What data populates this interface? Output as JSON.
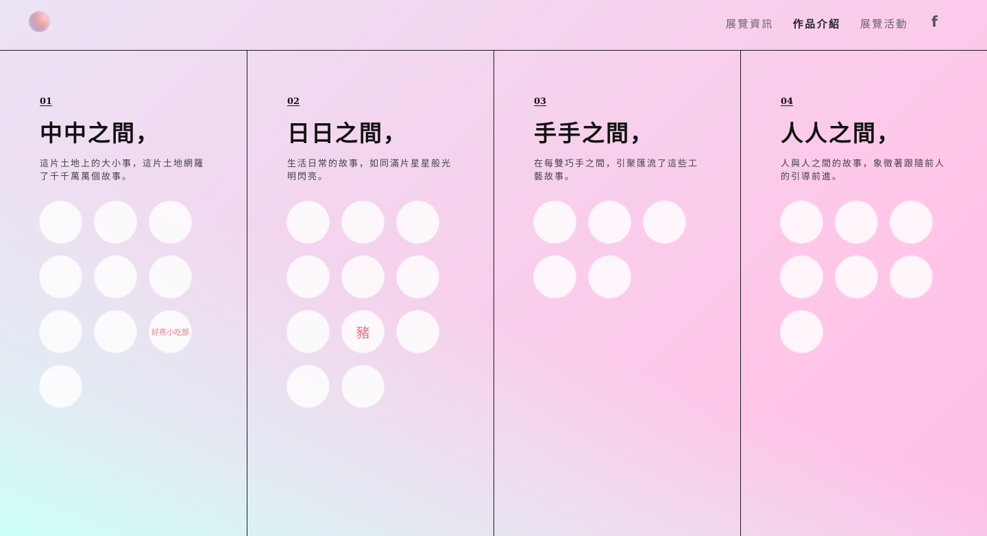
{
  "header": {
    "nav": [
      {
        "label": "展覽資訊",
        "active": false
      },
      {
        "label": "作品介紹",
        "active": true
      },
      {
        "label": "展覽活動",
        "active": false
      }
    ],
    "facebook_icon": "f"
  },
  "columns": [
    {
      "number": "01",
      "title": "中中之間，",
      "description": "這片土地上的大小事，這片土地網羅了千千萬萬個故事。",
      "badges": [
        {
          "text": "",
          "icon": "book-logo"
        },
        {
          "text": "",
          "icon": "house-logo"
        },
        {
          "text": "",
          "icon": "mountain-logo"
        },
        {
          "text": "",
          "icon": "shop-logo"
        },
        {
          "text": "",
          "icon": "lines-logo"
        },
        {
          "text": "",
          "icon": "flower-logo"
        },
        {
          "text": "",
          "icon": "character-logo"
        },
        {
          "text": "",
          "icon": "tiger-logo"
        },
        {
          "text": "好燕小吃部",
          "icon": "text-logo"
        },
        {
          "text": "",
          "icon": "calligraphy-logo"
        }
      ]
    },
    {
      "number": "02",
      "title": "日日之間，",
      "description": "生活日常的故事，如同滿片星星般光明閃亮。",
      "badges": [
        {
          "text": "",
          "icon": "script-logo"
        },
        {
          "text": "",
          "icon": "bloom-logo"
        },
        {
          "text": "",
          "icon": "lily-logo"
        },
        {
          "text": "",
          "icon": "stage-logo"
        },
        {
          "text": "",
          "icon": "cake-logo"
        },
        {
          "text": "",
          "icon": "calligraphy-logo"
        },
        {
          "text": "",
          "icon": "ribbon-logo"
        },
        {
          "text": "豬",
          "icon": "pig-logo"
        },
        {
          "text": "",
          "icon": "bowl-logo"
        },
        {
          "text": "",
          "icon": "circle-logo"
        },
        {
          "text": "",
          "icon": "lotus-logo"
        }
      ]
    },
    {
      "number": "03",
      "title": "手手之間，",
      "description": "在每雙巧手之間，引聚匯流了這些工藝故事。",
      "badges": [
        {
          "text": "",
          "icon": "line-logo"
        },
        {
          "text": "",
          "icon": "hand-logo"
        },
        {
          "text": "",
          "icon": "script-logo"
        },
        {
          "text": "",
          "icon": "flower-char-logo"
        },
        {
          "text": "",
          "icon": "face-logo"
        }
      ]
    },
    {
      "number": "04",
      "title": "人人之間，",
      "description": "人與人之間的故事，象徵著跟隨前人的引導前進。",
      "badges": [
        {
          "text": "",
          "icon": "portrait-logo"
        },
        {
          "text": "",
          "icon": "figure-logo"
        },
        {
          "text": "",
          "icon": "eye-logo"
        },
        {
          "text": "",
          "icon": "doll-logo"
        },
        {
          "text": "",
          "icon": "fortune-logo"
        },
        {
          "text": "",
          "icon": "seal-logo"
        },
        {
          "text": "",
          "icon": "script-logo"
        }
      ]
    }
  ]
}
